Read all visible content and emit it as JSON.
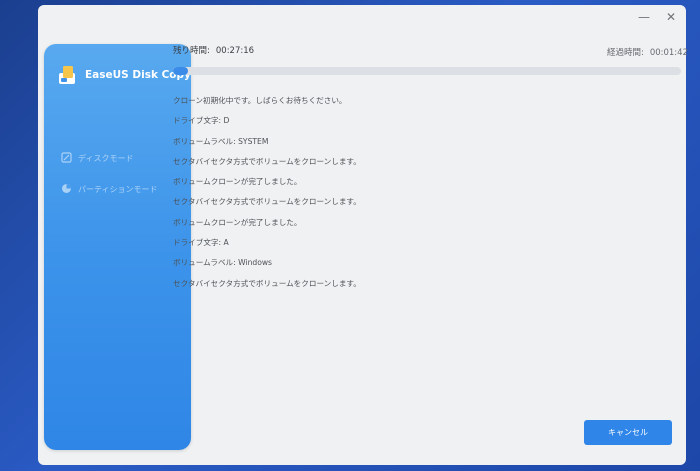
{
  "window": {
    "minimize_icon": "minimize-icon",
    "close_icon": "close-icon"
  },
  "sidebar": {
    "app_name": "EaseUS Disk Copy",
    "items": [
      {
        "label": "ディスクモード",
        "icon": "disk-mode-icon"
      },
      {
        "label": "パーティションモード",
        "icon": "pie-chart-icon"
      }
    ]
  },
  "status": {
    "remaining_label": "残り時間:",
    "remaining_time": "00:27:16",
    "elapsed_label": "経過時間:",
    "elapsed_time": "00:01:42",
    "progress": 0.03
  },
  "log": [
    "クローン初期化中です。しばらくお待ちください。",
    "ドライブ文字: D",
    "ボリュームラベル: SYSTEM",
    "セクタバイセクタ方式でボリュームをクローンします。",
    "ボリュームクローンが完了しました。",
    "セクタバイセクタ方式でボリュームをクローンします。",
    "ボリュームクローンが完了しました。",
    "ドライブ文字: A",
    "ボリュームラベル: Windows",
    "セクタバイセクタ方式でボリュームをクローンします。"
  ],
  "buttons": {
    "cancel": "キャンセル"
  },
  "colors": {
    "accent": "#2f86e8",
    "sidebar_top": "#58a9ef",
    "sidebar_bottom": "#2f86e6"
  }
}
